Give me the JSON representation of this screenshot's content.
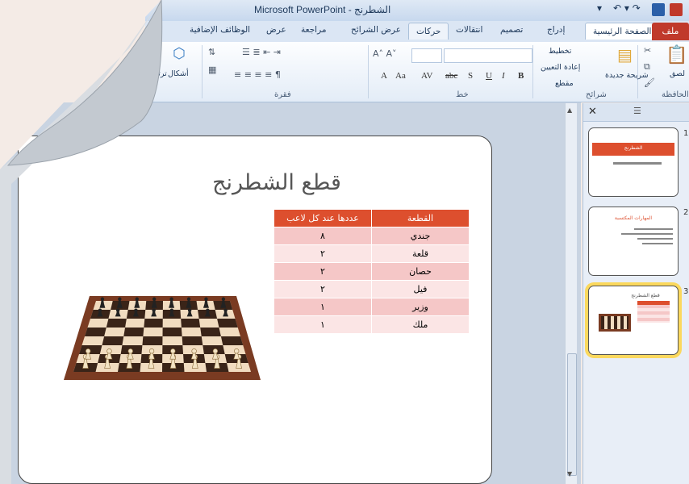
{
  "window": {
    "title": "Microsoft PowerPoint - الشطرنج"
  },
  "tabs": [
    "ملف",
    "الصفحة الرئيسية",
    "إدراج",
    "تصميم",
    "انتقالات",
    "حركات",
    "عرض الشرائح",
    "مراجعة",
    "عرض",
    "الوظائف الإضافية"
  ],
  "ribbon": {
    "groups": {
      "clipboard": "الحافظة",
      "slides": "شرائح",
      "font": "خط",
      "paragraph": "فقرة"
    },
    "paste_label": "لصق",
    "new_slide_label": "شريحة جديدة",
    "layout_label": "تخطيط",
    "reset_label": "إعادة التعيين",
    "section_label": "مقطع",
    "shapes_label": "أشكال",
    "arrange_label": "ترتيب",
    "font_buttons": [
      "B",
      "I",
      "U",
      "S",
      "abc",
      "AV",
      "Aa",
      "A"
    ]
  },
  "slide": {
    "title": "قطع الشطرنج",
    "table": {
      "headers": [
        "القطعة",
        "عددها عند كل لاعب"
      ],
      "rows": [
        [
          "جندي",
          "٨"
        ],
        [
          "قلعة",
          "٢"
        ],
        [
          "حصان",
          "٢"
        ],
        [
          "فيل",
          "٢"
        ],
        [
          "وزير",
          "١"
        ],
        [
          "ملك",
          "١"
        ]
      ]
    }
  },
  "thumbnails": {
    "slide1_title": "الشطرنج",
    "slide2_title": "المهارات المكتسبة",
    "slide3_title": "قطع الشطرنج",
    "numbers": [
      "1",
      "2",
      "3"
    ]
  },
  "colors": {
    "accent": "#dd4f2e",
    "row_dark": "#f5c7c7",
    "row_light": "#fbe5e5",
    "file_tab": "#c0392b"
  }
}
